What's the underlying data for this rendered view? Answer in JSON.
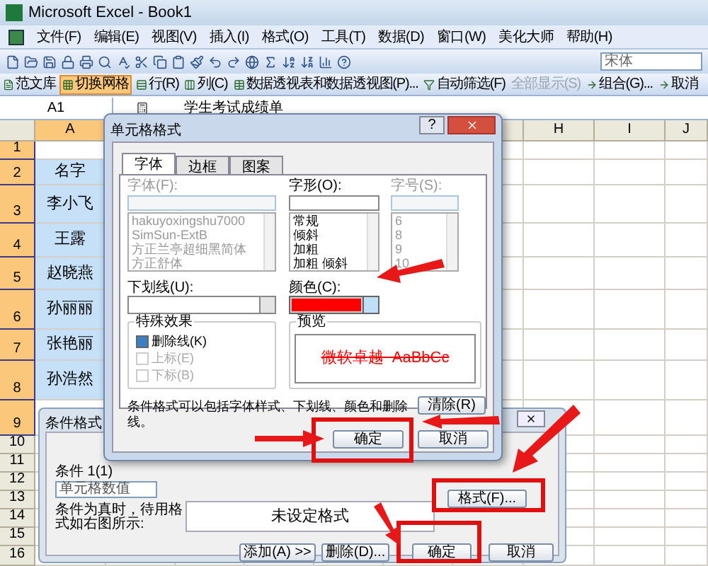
{
  "window": {
    "title": "Microsoft Excel - Book1"
  },
  "menu": [
    "文件(F)",
    "编辑(E)",
    "视图(V)",
    "插入(I)",
    "格式(O)",
    "工具(T)",
    "数据(D)",
    "窗口(W)",
    "美化大师",
    "帮助(H)"
  ],
  "font_box": {
    "value": "宋体"
  },
  "toolbar": [
    {
      "label": "范文库",
      "selected": false,
      "disabled": false
    },
    {
      "label": "切换网格",
      "selected": true,
      "disabled": false
    },
    {
      "label": "行(R)",
      "selected": false,
      "disabled": false
    },
    {
      "label": "列(C)",
      "selected": false,
      "disabled": false
    },
    {
      "label": "数据透视表和数据透视图(P)...",
      "selected": false,
      "disabled": false
    },
    {
      "label": "自动筛选(F)",
      "selected": false,
      "disabled": false
    },
    {
      "label": "全部显示(S)",
      "selected": false,
      "disabled": true
    },
    {
      "label": "组合(G)...",
      "selected": false,
      "disabled": false
    },
    {
      "label": "取消",
      "selected": false,
      "disabled": false
    }
  ],
  "formula_bar": {
    "cell": "A1",
    "content": "学生考试成绩单"
  },
  "columns": [
    "A",
    "H",
    "I",
    "J"
  ],
  "rows": [
    {
      "number": "1",
      "selected": true
    },
    {
      "number": "2",
      "selected": true,
      "value": "名字"
    },
    {
      "number": "3",
      "selected": true,
      "value": "李小飞"
    },
    {
      "number": "4",
      "selected": true,
      "value": "王露"
    },
    {
      "number": "5",
      "selected": true,
      "value": "赵晓燕"
    },
    {
      "number": "6",
      "selected": true,
      "value": "孙丽丽"
    },
    {
      "number": "7",
      "selected": true,
      "value": "张艳丽"
    },
    {
      "number": "8",
      "selected": true,
      "value": "孙浩然"
    },
    {
      "number": "9",
      "selected": true
    },
    {
      "number": "10",
      "selected": false
    },
    {
      "number": "11",
      "selected": false
    },
    {
      "number": "12",
      "selected": false
    },
    {
      "number": "13",
      "selected": false
    },
    {
      "number": "14",
      "selected": false
    },
    {
      "number": "15",
      "selected": false
    },
    {
      "number": "16",
      "selected": false
    }
  ],
  "format_dialog": {
    "title": "单元格格式",
    "help": "?",
    "tabs": [
      {
        "label": "字体",
        "selected": true
      },
      {
        "label": "边框",
        "selected": false
      },
      {
        "label": "图案",
        "selected": false
      }
    ],
    "fields": [
      {
        "label": "字体(F):",
        "disabled": true,
        "items": [
          "hakuyoxingshu7000",
          "SimSun-ExtB",
          "方正兰亭超细黑简体",
          "方正舒体"
        ]
      },
      {
        "label": "字形(O):",
        "disabled": false,
        "items": [
          "常规",
          "倾斜",
          "加粗",
          "加粗 倾斜"
        ]
      },
      {
        "label": "字号(S):",
        "disabled": true,
        "items": [
          "6",
          "8",
          "9",
          "10"
        ]
      }
    ],
    "underline_label": "下划线(U):",
    "color_label": "颜色(C):",
    "color": "#ff0000",
    "effects_label": "特殊效果",
    "effects": [
      {
        "label": "删除线(K)",
        "checked": true,
        "disabled": false
      },
      {
        "label": "上标(E)",
        "checked": false,
        "disabled": true
      },
      {
        "label": "下标(B)",
        "checked": false,
        "disabled": true
      }
    ],
    "preview_label": "预览",
    "preview_text": "微软卓越  AaBbCc",
    "note": "条件格式可以包括字体样式、下划线、颜色和删除线。",
    "clear": "清除(R)",
    "ok": "确定",
    "cancel": "取消"
  },
  "condition_dialog": {
    "title": "条件格式",
    "condition_label": "条件 1(1)",
    "operand": "单元格数值",
    "when_true_label": "条件为真时，待用格式如右图所示:",
    "format_preview": "未设定格式",
    "format": "格式(F)...",
    "add": "添加(A) >>",
    "delete": "删除(D)...",
    "ok": "确定",
    "cancel": "取消"
  }
}
